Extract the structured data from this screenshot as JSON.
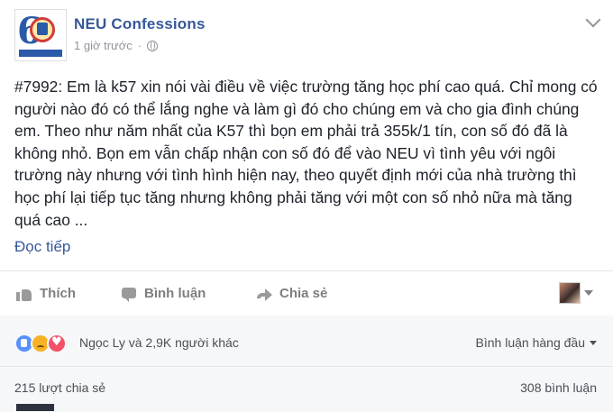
{
  "page": {
    "name": "NEU Confessions",
    "time": "1 giờ trước",
    "separator": "·",
    "privacy_icon": "globe-icon",
    "menu_icon": "chevron-down-icon"
  },
  "post": {
    "body": "#7992: Em là k57 xin nói vài điều về việc trường tăng học phí cao quá. Chỉ mong có người nào đó có thể lắng nghe và làm gì đó cho chúng em và cho gia đình chúng em. Theo như năm nhất của K57 thì bọn em phải trả 355k/1 tín, con số đó đã là không nhỏ. Bọn em vẫn chấp nhận con số đó để vào NEU vì tình yêu với ngôi trường này nhưng với tình hình hiện nay, theo quyết định mới của nhà trường thì học phí lại tiếp tục tăng nhưng không phải tăng với một con số nhỏ nữa mà tăng quá cao ...",
    "read_more": "Đọc tiếp"
  },
  "actions": {
    "like": "Thích",
    "comment": "Bình luận",
    "share": "Chia sẻ"
  },
  "reactions": {
    "icons": [
      "like-icon",
      "sad-icon",
      "love-icon"
    ],
    "summary": "Ngọc Ly và 2,9K người khác",
    "sort_label": "Bình luận hàng đầu"
  },
  "stats": {
    "shares": "215 lượt chia sẻ",
    "comments": "308 bình luận"
  },
  "colors": {
    "link_blue": "#365899",
    "meta_gray": "#90949c",
    "reaction_bg": "#f6f7f9"
  }
}
